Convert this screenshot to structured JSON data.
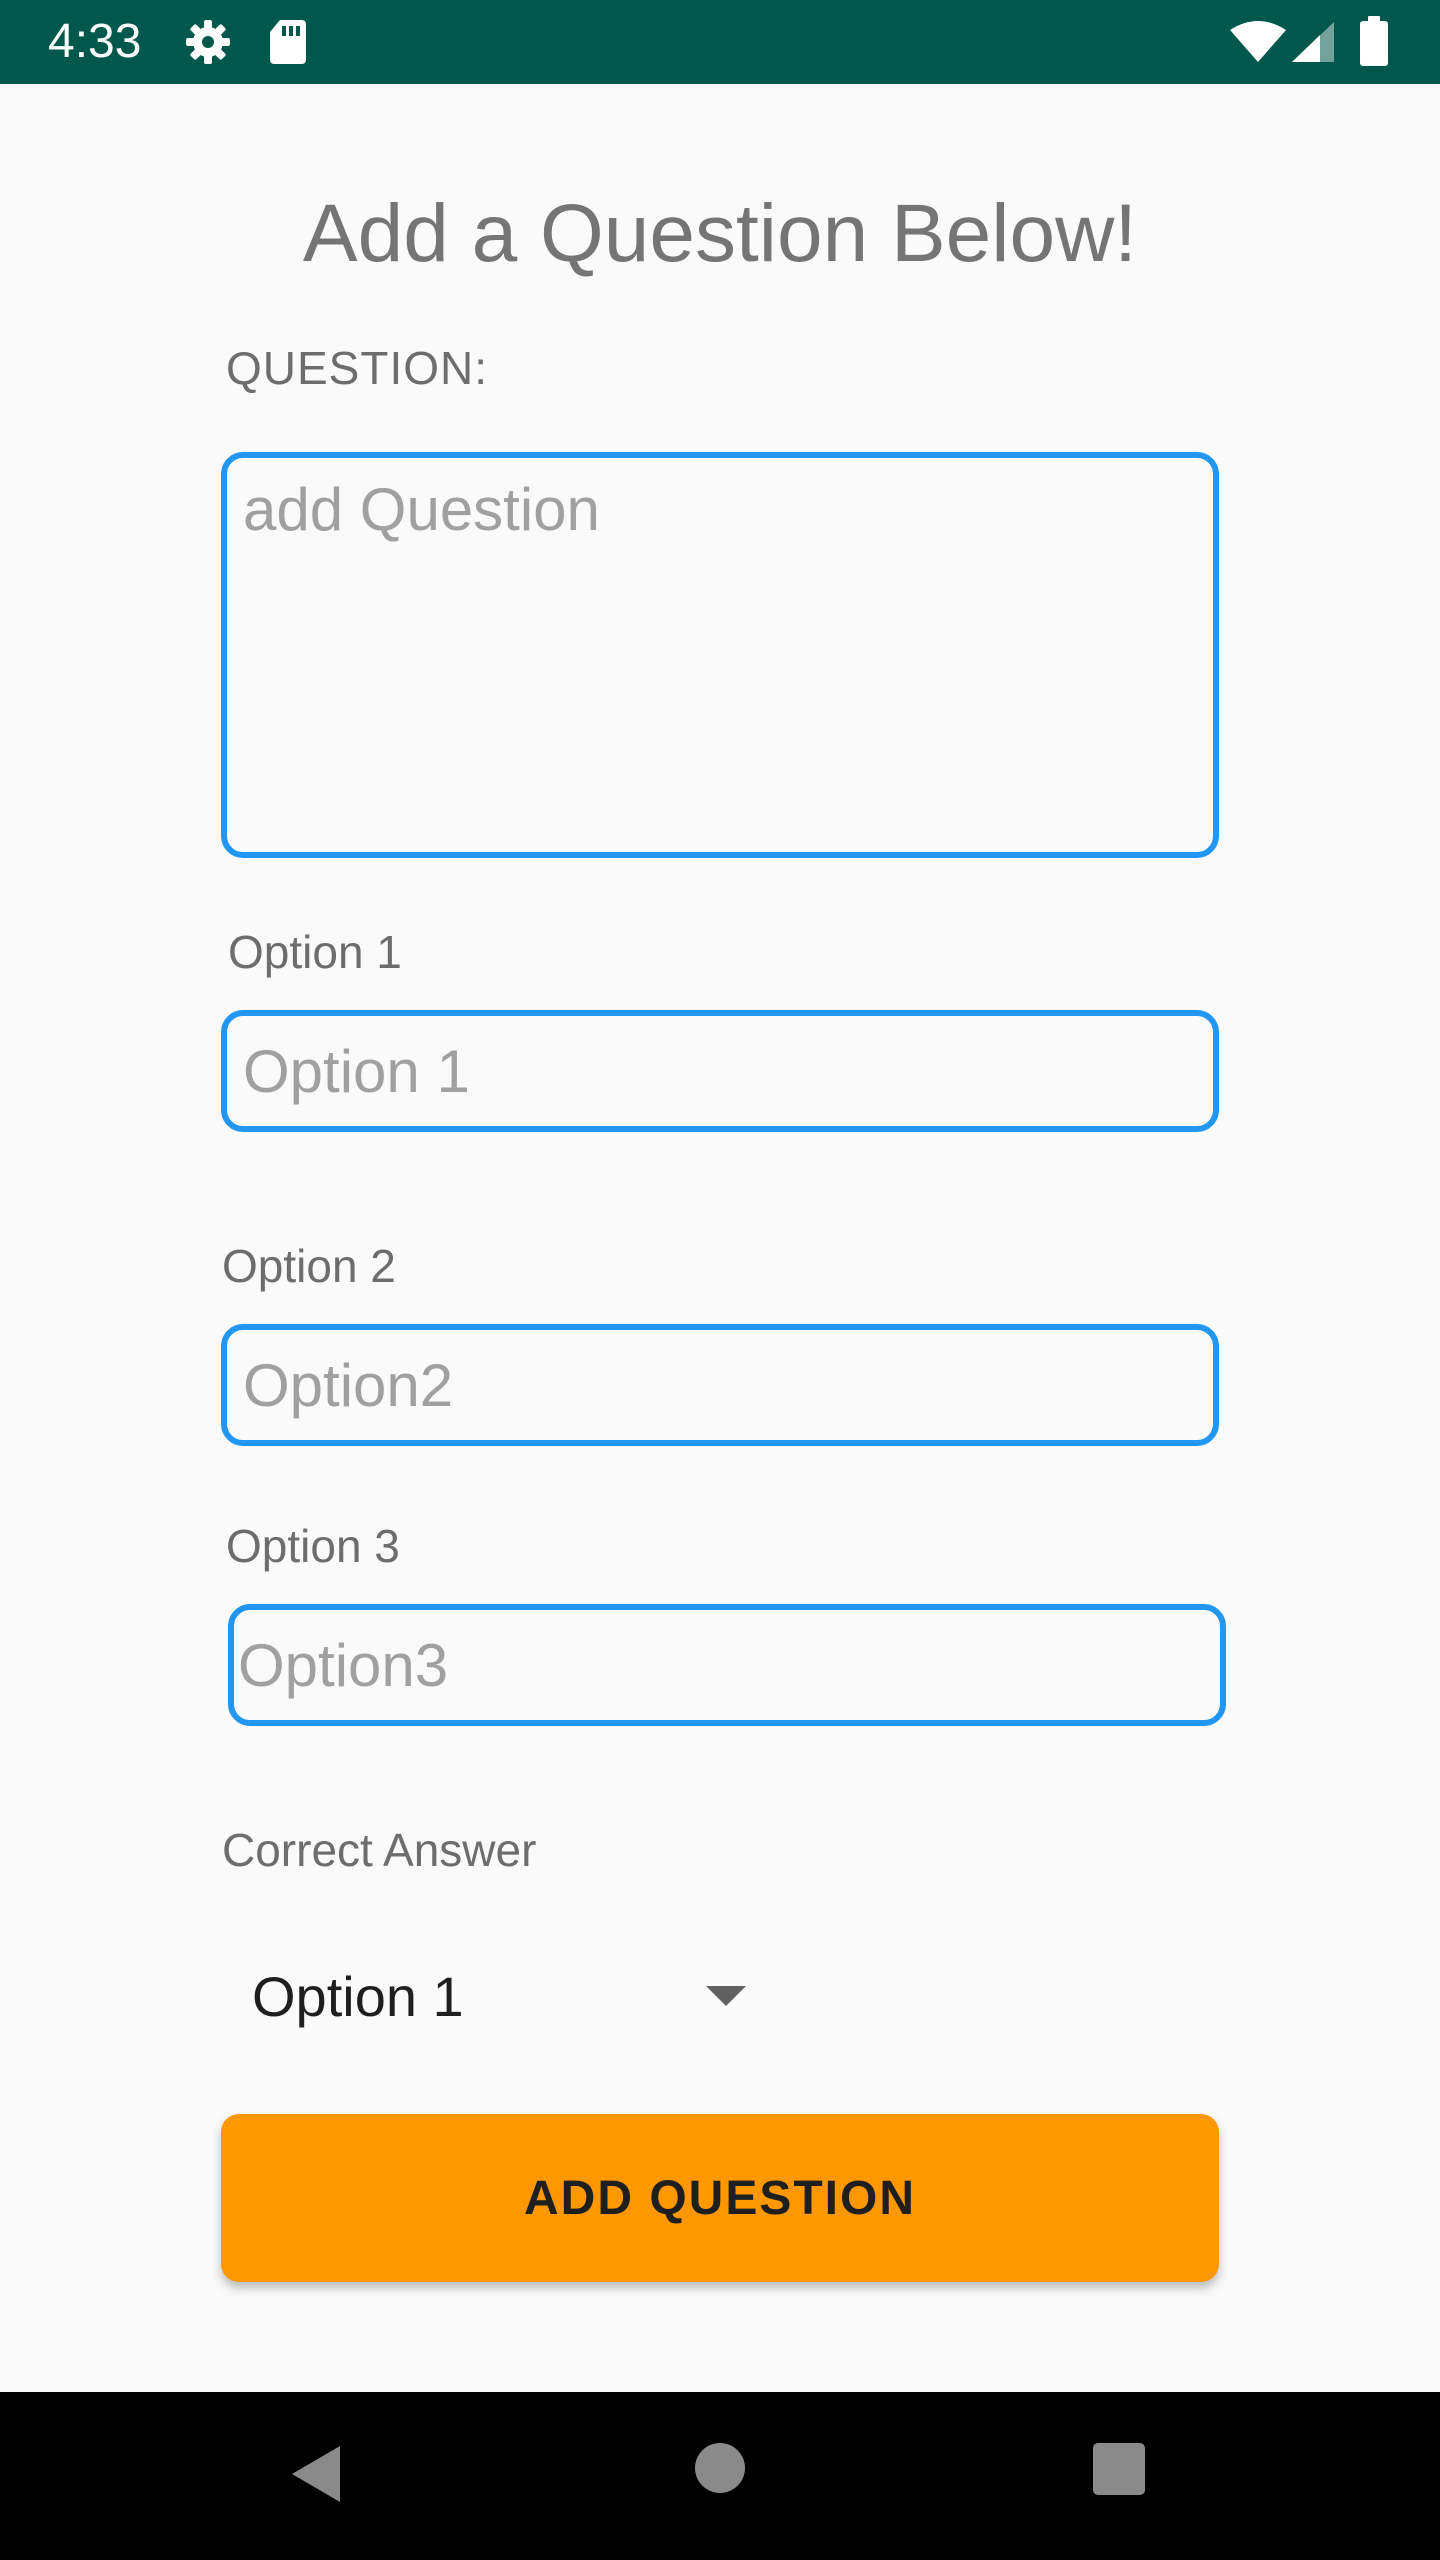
{
  "status_bar": {
    "time": "4:33",
    "icons": [
      "gear-icon",
      "sd-card-icon",
      "wifi-icon",
      "cell-signal-icon",
      "battery-icon"
    ],
    "background_color": "#00574b"
  },
  "page": {
    "title": "Add a Question Below!"
  },
  "question": {
    "label": "QUESTION:",
    "placeholder": "add Question",
    "value": ""
  },
  "options": [
    {
      "label": "Option 1",
      "placeholder": "Option 1",
      "value": ""
    },
    {
      "label": "Option 2",
      "placeholder": "Option2",
      "value": ""
    },
    {
      "label": "Option 3",
      "placeholder": "Option3",
      "value": ""
    }
  ],
  "correct_answer": {
    "label": "Correct Answer",
    "selected": "Option 1"
  },
  "add_button": {
    "label": "ADD QUESTION",
    "color": "#ff9800"
  },
  "accent_color": "#2196f3",
  "nav_bar": {
    "icons": [
      "back-icon",
      "home-icon",
      "recents-icon"
    ]
  }
}
